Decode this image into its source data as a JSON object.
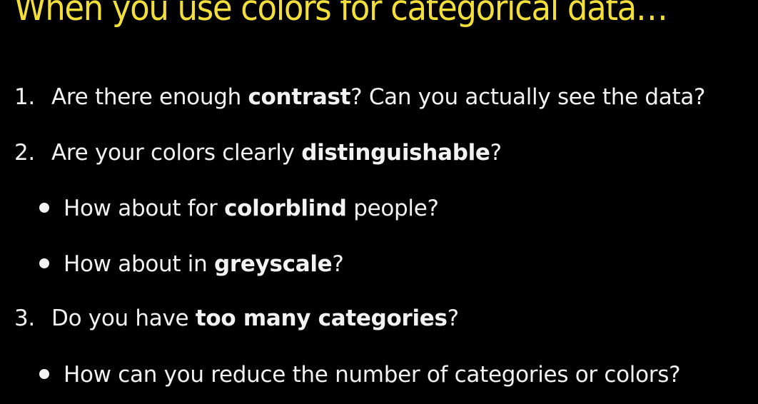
{
  "slide": {
    "title": "When you use colors for categorical data…",
    "item1": {
      "number": "1.",
      "pre": "Are there enough ",
      "bold": "contrast",
      "post": "? Can you actually see the data?"
    },
    "item2": {
      "number": "2.",
      "pre": "Are your colors clearly ",
      "bold": "distinguishable",
      "post": "?",
      "bullets": [
        {
          "pre": "How about for ",
          "bold": "colorblind",
          "post": " people?"
        },
        {
          "pre": "How about in ",
          "bold": "greyscale",
          "post": "?"
        }
      ]
    },
    "item3": {
      "number": "3.",
      "pre": "Do you have ",
      "bold": "too many categories",
      "post": "?",
      "bullets": [
        {
          "text": "How can you reduce the number of categories or colors?"
        }
      ]
    },
    "colors": {
      "background": "#000000",
      "title": "#f2df3a",
      "text": "#f2f2f2"
    }
  }
}
